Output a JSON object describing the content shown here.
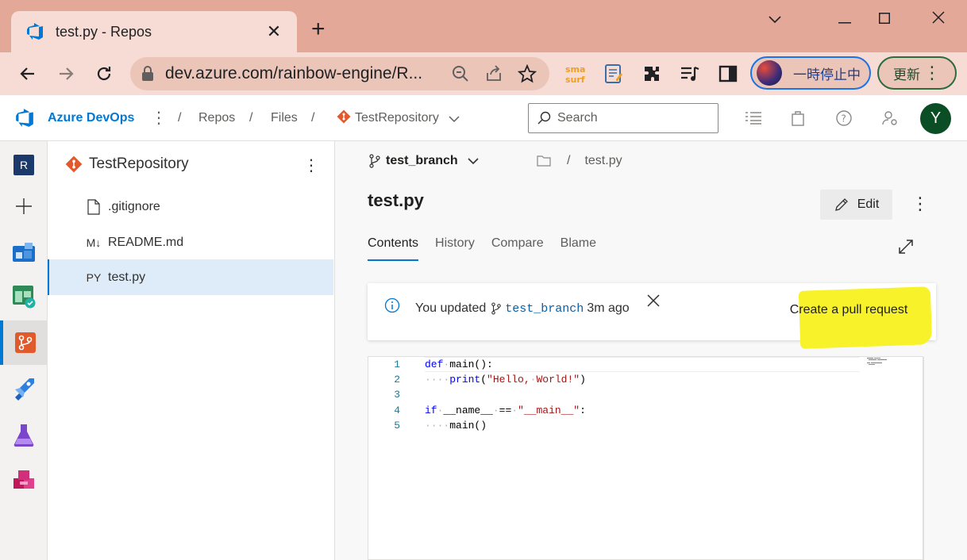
{
  "browser": {
    "tab_title": "test.py - Repos",
    "url": "dev.azure.com/rainbow-engine/R...",
    "profile_text": "一時停止中",
    "update_text": "更新"
  },
  "header": {
    "brand": "Azure DevOps",
    "crumbs": [
      "Repos",
      "Files",
      "TestRepository"
    ],
    "search_placeholder": "Search",
    "user_initial": "Y"
  },
  "rail": {
    "project_initial": "R"
  },
  "tree": {
    "repo_name": "TestRepository",
    "items": [
      {
        "icon": ".",
        "label": ".gitignore"
      },
      {
        "icon": "M↓",
        "label": "README.md"
      },
      {
        "icon": "PY",
        "label": "test.py"
      }
    ]
  },
  "main": {
    "branch": "test_branch",
    "path_sep": "/",
    "path_file": "test.py",
    "file_title": "test.py",
    "edit_label": "Edit",
    "tabs": [
      "Contents",
      "History",
      "Compare",
      "Blame"
    ],
    "banner": {
      "prefix": "You updated",
      "branch": "test_branch",
      "suffix": "3m ago",
      "pr_label": "Create a pull request"
    },
    "code": {
      "line_numbers": [
        "1",
        "2",
        "3",
        "4",
        "5"
      ]
    }
  },
  "colors": {
    "accent": "#0078d4",
    "highlight": "#f8f22a",
    "tab_bar": "#e3a898"
  }
}
